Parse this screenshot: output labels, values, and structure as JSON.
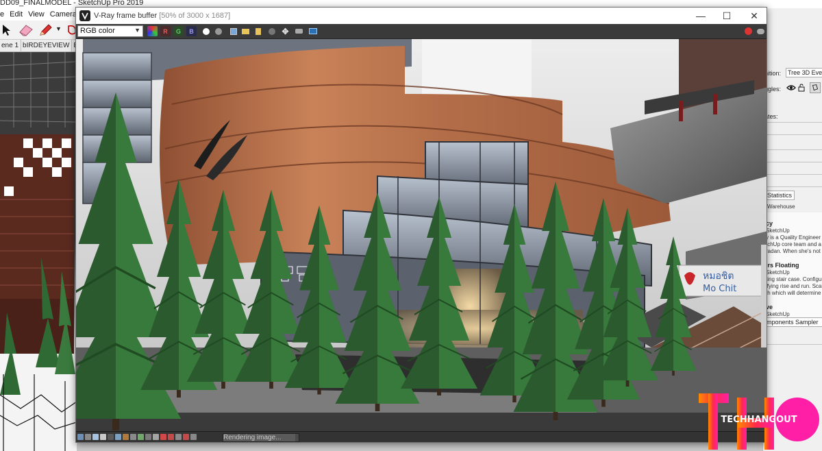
{
  "sketchup": {
    "title": "DD09_FINALMODEL - SketchUp Pro 2019",
    "menu": [
      "e",
      "Edit",
      "View",
      "Camera"
    ],
    "scene_tabs": [
      "ene 1",
      "bIRDEYEVIEW",
      "EL"
    ],
    "tray": {
      "definition_label": "nition:",
      "definition_value": "Tree 3D Ever",
      "toggles_label": "ggles:",
      "states_label": "ates:",
      "statistics_tab": "Statistics",
      "warehouse_text": "Warehouse",
      "items": [
        {
          "title": "cy",
          "lines": [
            "SketchUp",
            "y is a Quality Engineer or",
            "tchUp core team and a n",
            "radan. When she's not lo"
          ]
        },
        {
          "title": "irs Floating",
          "lines": [
            "SketchUp",
            "ting stair case. Configure",
            "ifying rise and run.  Scal",
            "th which will determine y"
          ]
        },
        {
          "title": "ve",
          "lines": [
            "SketchUp"
          ]
        }
      ],
      "sampler_text": "mponents Sampler"
    }
  },
  "vfb": {
    "title": "V-Ray frame buffer",
    "title_detail": "[50% of 3000 x 1687]",
    "window_controls": {
      "minimize": "—",
      "maximize": "☐",
      "close": "✕"
    },
    "channel": "RGB color",
    "channel_buttons": [
      "R",
      "G",
      "B"
    ],
    "status": "Rendering image...",
    "render_progress": 0.95
  },
  "render_signage": {
    "line1": "หมอชิต",
    "line2": "Mo Chit"
  },
  "watermark": {
    "letters": "THO",
    "text": "TECHHANGOUT"
  }
}
